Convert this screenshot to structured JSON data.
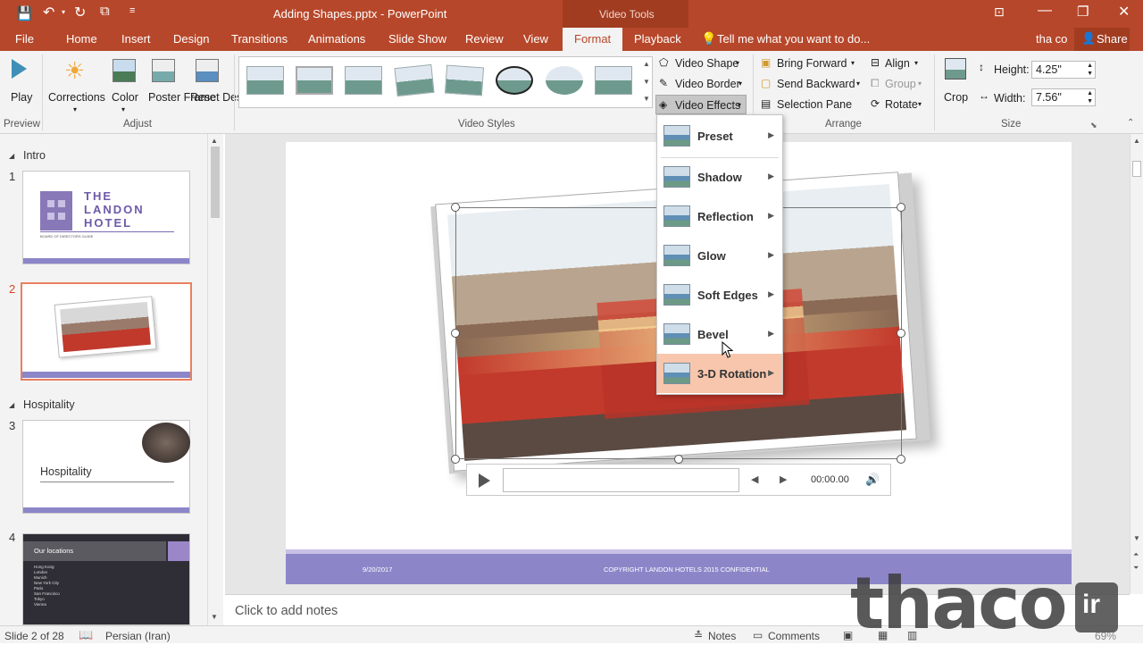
{
  "title_bar": {
    "doc_title": "Adding Shapes.pptx - PowerPoint",
    "context_tab": "Video Tools"
  },
  "tabs": [
    "File",
    "Home",
    "Insert",
    "Design",
    "Transitions",
    "Animations",
    "Slide Show",
    "Review",
    "View",
    "Format",
    "Playback"
  ],
  "tell_me": "Tell me what you want to do...",
  "user": "tha co",
  "share": "Share",
  "ribbon": {
    "preview": {
      "play": "Play",
      "group": "Preview"
    },
    "adjust": {
      "corrections": "Corrections",
      "color": "Color",
      "poster_frame": "Poster Frame",
      "reset_design": "Reset Design",
      "group": "Adjust"
    },
    "video_styles_group": "Video Styles",
    "video_shape": "Video Shape",
    "video_border": "Video Border",
    "video_effects": "Video Effects",
    "arrange": {
      "bring_forward": "Bring Forward",
      "send_backward": "Send Backward",
      "selection_pane": "Selection Pane",
      "align": "Align",
      "group_btn": "Group",
      "rotate": "Rotate",
      "group": "Arrange"
    },
    "size": {
      "crop": "Crop",
      "height_label": "Height:",
      "height_value": "4.25\"",
      "width_label": "Width:",
      "width_value": "7.56\"",
      "group": "Size"
    }
  },
  "effects_menu": [
    "Preset",
    "Shadow",
    "Reflection",
    "Glow",
    "Soft Edges",
    "Bevel",
    "3-D Rotation"
  ],
  "slides_panel": {
    "sections": [
      "Intro",
      "Hospitality"
    ],
    "slides": [
      {
        "num": "1",
        "title_lines": [
          "THE",
          "LANDON",
          "HOTEL"
        ],
        "subtitle": "BOARD OF DIRECTORS GUIDE"
      },
      {
        "num": "2"
      },
      {
        "num": "3",
        "title": "Hospitality"
      },
      {
        "num": "4",
        "title": "Our locations",
        "items": [
          "Hong Kong",
          "London",
          "Munich",
          "New York City",
          "Paris",
          "San Francisco",
          "Tokyo",
          "Vienna"
        ]
      }
    ]
  },
  "slide": {
    "date": "9/20/2017",
    "footer": "COPYRIGHT LANDON HOTELS 2015 CONFIDENTIAL"
  },
  "player": {
    "time": "00:00.00"
  },
  "notes_placeholder": "Click to add notes",
  "status": {
    "slide_info": "Slide 2 of 28",
    "language": "Persian (Iran)",
    "notes": "Notes",
    "comments": "Comments",
    "zoom": "69%"
  },
  "watermark": {
    "text": "thaco",
    "badge": "ir"
  },
  "colors": {
    "accent": "#b7472a",
    "menu_highlight": "#f7c6ad",
    "footer_bar": "#8c86c9"
  }
}
